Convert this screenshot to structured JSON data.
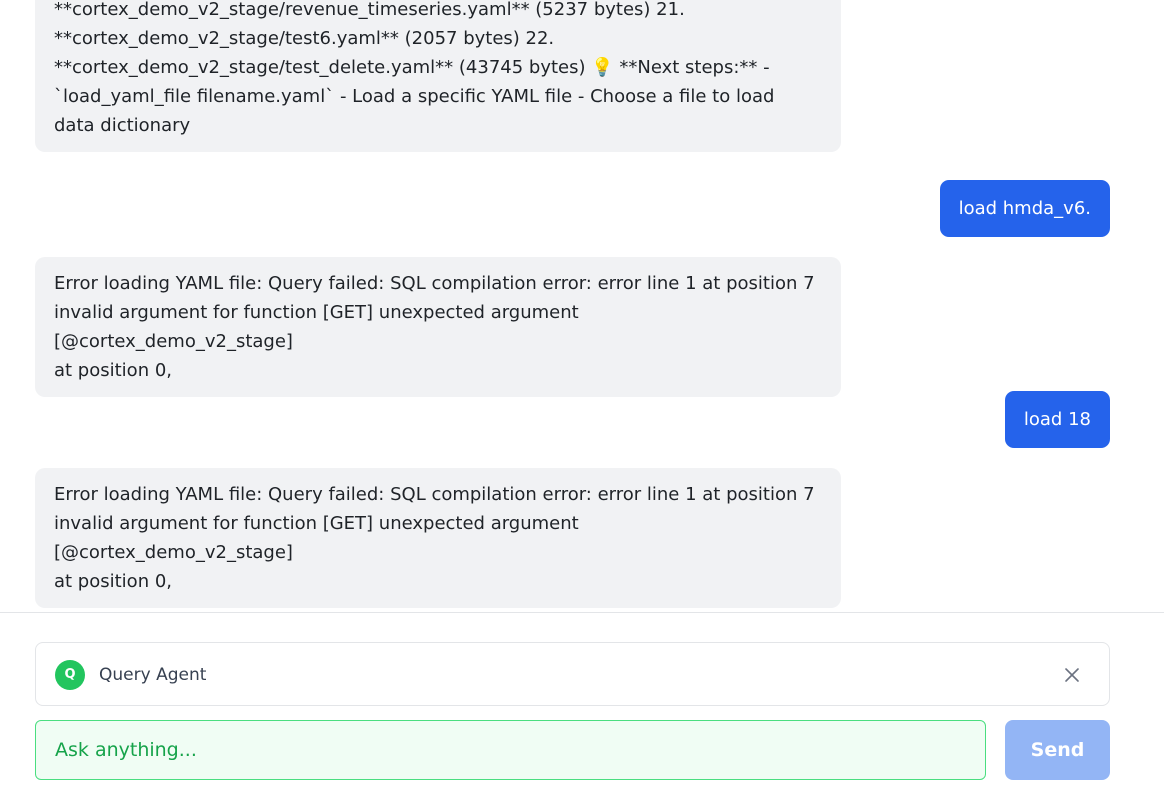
{
  "messages": [
    {
      "role": "assistant",
      "text": "**cortex_demo_v2_stage/revenue_timeseries.yaml** (5237 bytes) 21.\n**cortex_demo_v2_stage/test6.yaml** (2057 bytes) 22.\n**cortex_demo_v2_stage/test_delete.yaml** (43745 bytes) 💡 **Next steps:** -\n`load_yaml_file filename.yaml` - Load a specific YAML file - Choose a file to load\ndata dictionary"
    },
    {
      "role": "user",
      "text": "load hmda_v6."
    },
    {
      "role": "assistant",
      "text": "Error loading YAML file: Query failed: SQL compilation error: error line 1 at position 7\ninvalid argument for function [GET] unexpected argument [@cortex_demo_v2_stage]\nat position 0,"
    },
    {
      "role": "user",
      "text": "load 18"
    },
    {
      "role": "assistant",
      "text": "Error loading YAML file: Query failed: SQL compilation error: error line 1 at position 7\ninvalid argument for function [GET] unexpected argument [@cortex_demo_v2_stage]\nat position 0,"
    }
  ],
  "agent": {
    "badge_letter": "Q",
    "name": "Query Agent",
    "close_icon": "close-icon",
    "badge_color": "#22c55e"
  },
  "composer": {
    "placeholder": "Ask anything...",
    "value": "",
    "send_label": "Send"
  },
  "colors": {
    "user_bubble": "#2563eb",
    "assistant_bubble": "#f1f2f4",
    "send_button_disabled": "#93b5f5",
    "input_border": "#4ade80"
  }
}
